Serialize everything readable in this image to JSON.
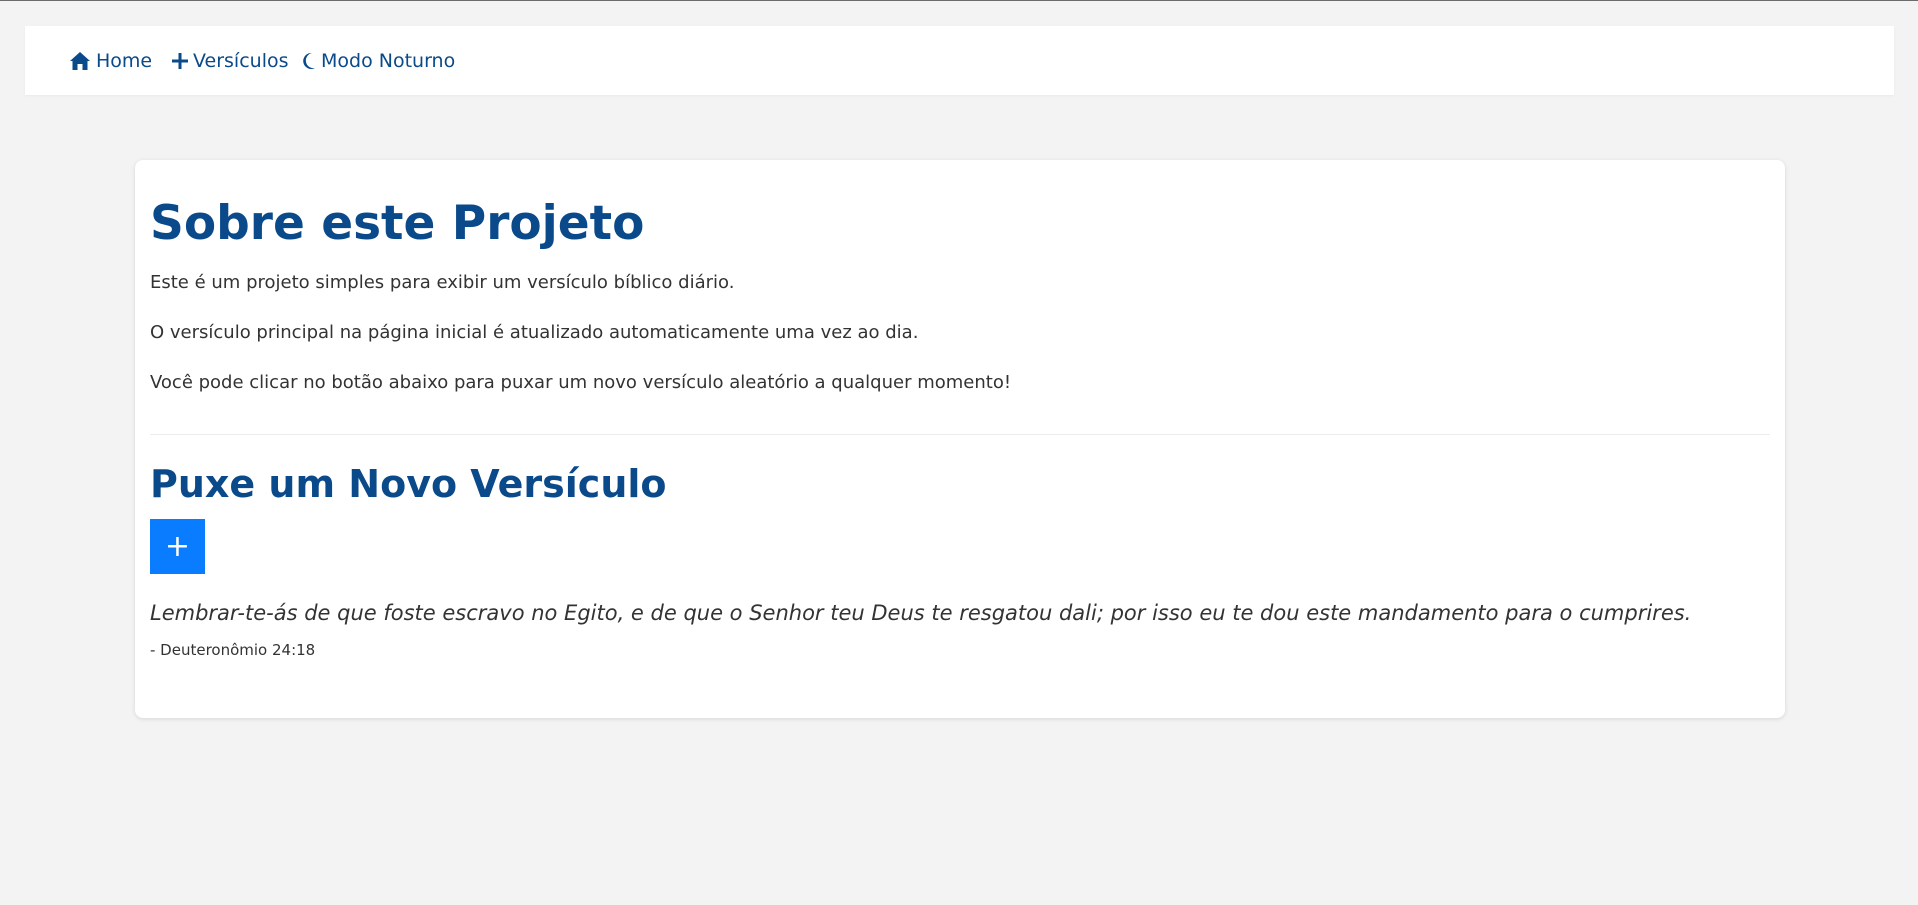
{
  "nav": {
    "home": {
      "label": "Home",
      "icon": "home-icon"
    },
    "verses": {
      "label": "Versículos",
      "icon": "plus-icon"
    },
    "night_mode": {
      "label": "Modo Noturno",
      "icon": "moon-icon"
    }
  },
  "about": {
    "title": "Sobre este Projeto",
    "paragraphs": [
      "Este é um projeto simples para exibir um versículo bíblico diário.",
      "O versículo principal na página inicial é atualizado automaticamente uma vez ao dia.",
      "Você pode clicar no botão abaixo para puxar um novo versículo aleatório a qualquer momento!"
    ]
  },
  "pull": {
    "title": "Puxe um Novo Versículo",
    "button_label": "+",
    "verse_text": "Lembrar-te-ás de que foste escravo no Egito, e de que o Senhor teu Deus te resgatou dali; por isso eu te dou este mandamento para o cumprires.",
    "verse_reference": "- Deuteronômio 24:18"
  },
  "colors": {
    "page_background": "#f3f3f3",
    "accent": "#0a4a8a",
    "button": "#0a7cff",
    "text": "#333333"
  }
}
